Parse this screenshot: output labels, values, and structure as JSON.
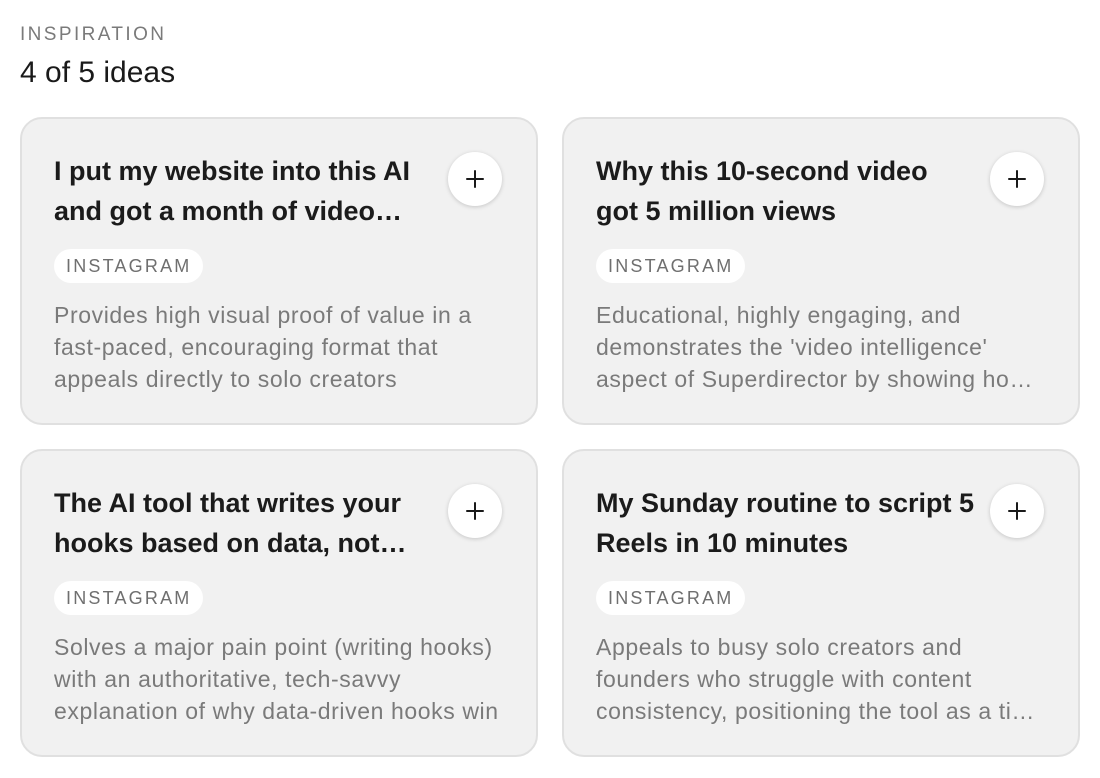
{
  "section": {
    "eyebrow": "INSPIRATION",
    "heading": "4 of 5 ideas"
  },
  "ideas": [
    {
      "title": "I put my website into this AI and got a month of video content",
      "platform": "INSTAGRAM",
      "description": "Provides high visual proof of value in a fast-paced, encouraging format that appeals directly to solo creators",
      "add_icon": "plus-icon"
    },
    {
      "title": "Why this 10-second video got 5 million views",
      "platform": "INSTAGRAM",
      "description": "Educational, highly engaging, and demonstrates the 'video intelligence' aspect of Superdirector by showing how it works",
      "add_icon": "plus-icon"
    },
    {
      "title": "The AI tool that writes your hooks based on data, not guesswork",
      "platform": "INSTAGRAM",
      "description": "Solves a major pain point (writing hooks) with an authoritative, tech-savvy explanation of why data-driven hooks win",
      "add_icon": "plus-icon"
    },
    {
      "title": "My Sunday routine to script 5 Reels in 10 minutes",
      "platform": "INSTAGRAM",
      "description": "Appeals to busy solo creators and founders who struggle with content consistency, positioning the tool as a time saver",
      "add_icon": "plus-icon"
    }
  ],
  "colors": {
    "card_background": "#f1f1f1",
    "card_border": "#e0e0e0",
    "muted_text": "#7a7a7a",
    "title_text": "#1b1b1b"
  }
}
